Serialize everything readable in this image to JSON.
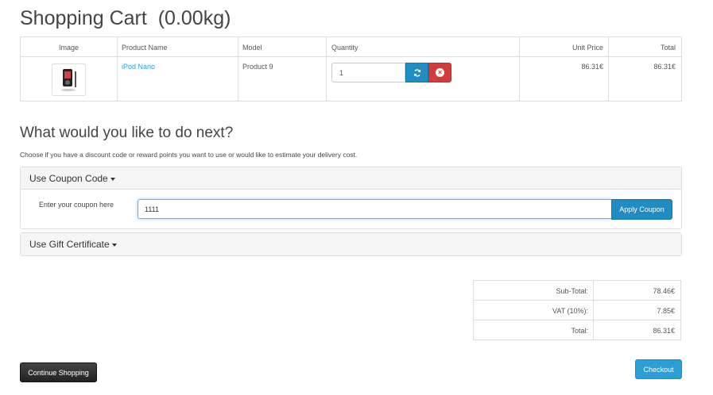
{
  "page": {
    "title": "Shopping Cart  (0.00kg)"
  },
  "cart": {
    "headers": {
      "image": "Image",
      "product_name": "Product Name",
      "model": "Model",
      "quantity": "Quantity",
      "unit_price": "Unit Price",
      "total": "Total"
    },
    "rows": [
      {
        "product_name": "iPod Nano",
        "model": "Product 9",
        "quantity": "1",
        "unit_price": "86.31€",
        "total": "86.31€"
      }
    ]
  },
  "next": {
    "title": "What would you like to do next?",
    "subtitle": "Choose if you have a discount code or reward points you want to use or would like to estimate your delivery cost."
  },
  "coupon": {
    "panel_title": "Use Coupon Code",
    "label": "Enter your coupon here",
    "value": "1111",
    "apply_label": "Apply Coupon"
  },
  "gift": {
    "panel_title": "Use Gift Certificate"
  },
  "totals": [
    {
      "label": "Sub-Total:",
      "value": "78.46€"
    },
    {
      "label": "VAT (10%):",
      "value": "7.85€"
    },
    {
      "label": "Total:",
      "value": "86.31€"
    }
  ],
  "actions": {
    "continue_label": "Continue Shopping",
    "checkout_label": "Checkout"
  },
  "colors": {
    "primary": "#2a9fd6",
    "danger": "#d23c3c",
    "dark": "#222222"
  }
}
